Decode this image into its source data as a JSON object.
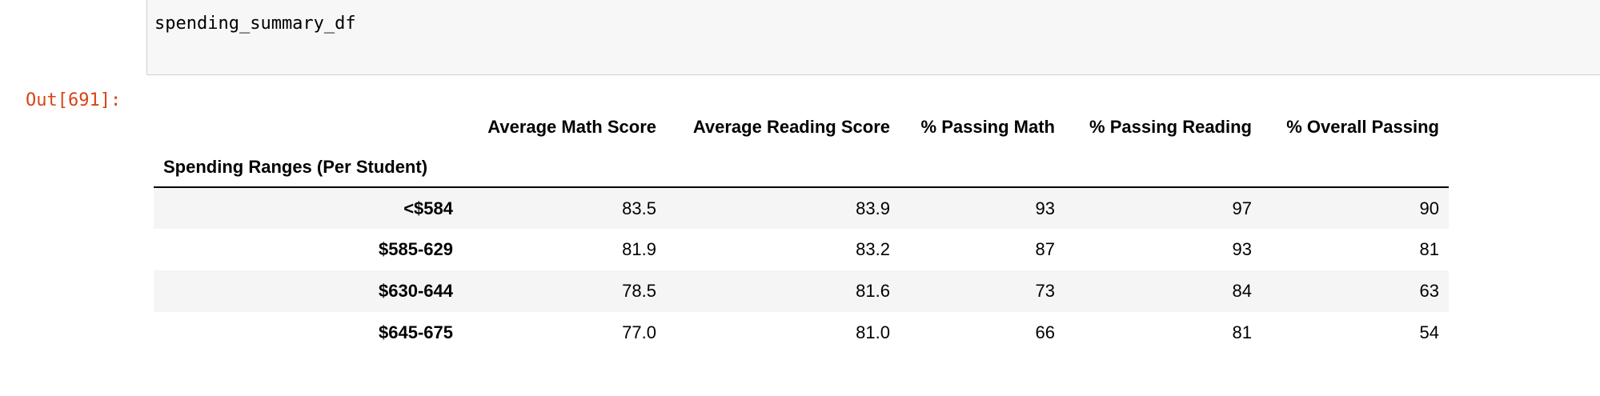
{
  "cell": {
    "code": "spending_summary_df",
    "out_prompt": "Out[691]:"
  },
  "table": {
    "columns": [
      "Average Math Score",
      "Average Reading Score",
      "% Passing Math",
      "% Passing Reading",
      "% Overall Passing"
    ],
    "index_name": "Spending Ranges (Per Student)",
    "rows": [
      {
        "label": "<$584",
        "values": [
          "83.5",
          "83.9",
          "93",
          "97",
          "90"
        ]
      },
      {
        "label": "$585-629",
        "values": [
          "81.9",
          "83.2",
          "87",
          "93",
          "81"
        ]
      },
      {
        "label": "$630-644",
        "values": [
          "78.5",
          "81.6",
          "73",
          "84",
          "63"
        ]
      },
      {
        "label": "$645-675",
        "values": [
          "77.0",
          "81.0",
          "66",
          "81",
          "54"
        ]
      }
    ]
  },
  "colors": {
    "prompt": "#d84315",
    "cell_bg": "#f7f7f7",
    "row_stripe": "#f5f5f5"
  }
}
